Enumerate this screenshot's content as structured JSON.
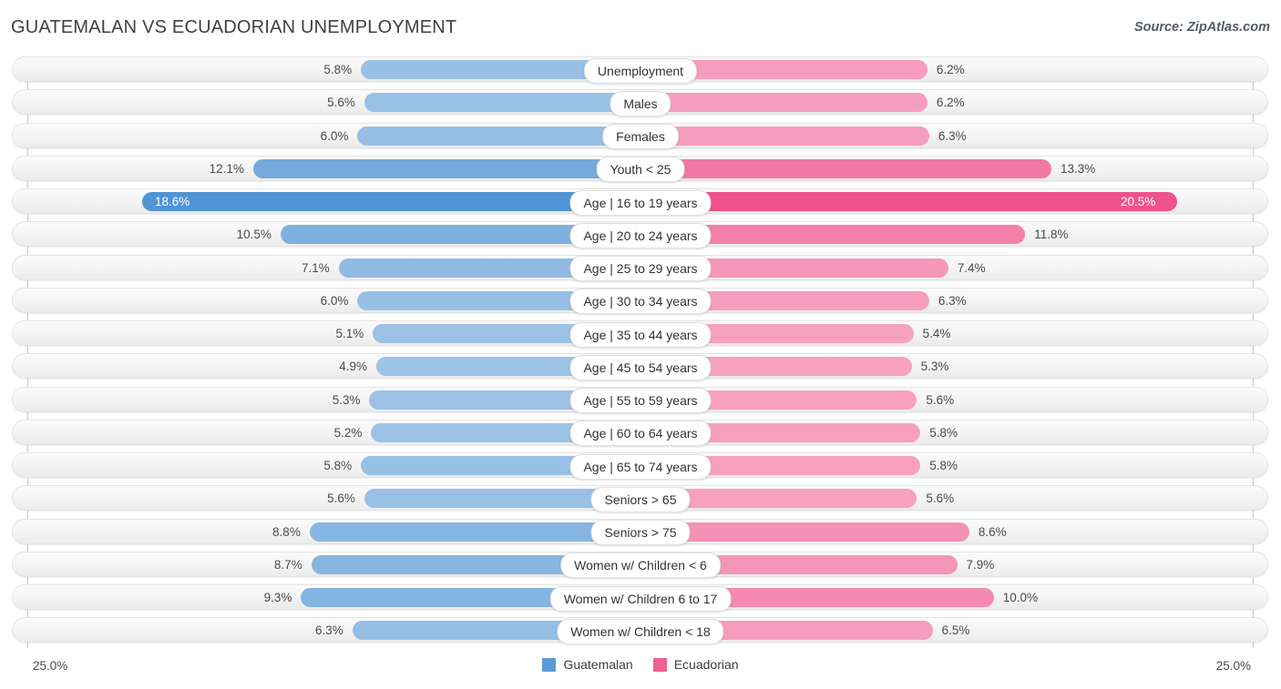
{
  "header": {
    "title": "GUATEMALAN VS ECUADORIAN UNEMPLOYMENT",
    "source": "Source: ZipAtlas.com"
  },
  "footer": {
    "axis_max_left": "25.0%",
    "axis_max_right": "25.0%",
    "legend": [
      {
        "label": "Guatemalan",
        "color": "#5b9bd5"
      },
      {
        "label": "Ecuadorian",
        "color": "#ef6093"
      }
    ]
  },
  "chart_data": {
    "type": "bar",
    "title": "GUATEMALAN VS ECUADORIAN UNEMPLOYMENT",
    "subtitle": "Source: ZipAtlas.com",
    "orientation": "horizontal-diverging",
    "xlabel": "",
    "ylabel": "",
    "xlim": [
      0,
      25
    ],
    "axis_max_label": "25.0%",
    "grid": false,
    "legend_position": "bottom-center",
    "categories": [
      "Unemployment",
      "Males",
      "Females",
      "Youth < 25",
      "Age | 16 to 19 years",
      "Age | 20 to 24 years",
      "Age | 25 to 29 years",
      "Age | 30 to 34 years",
      "Age | 35 to 44 years",
      "Age | 45 to 54 years",
      "Age | 55 to 59 years",
      "Age | 60 to 64 years",
      "Age | 65 to 74 years",
      "Seniors > 65",
      "Seniors > 75",
      "Women w/ Children < 6",
      "Women w/ Children 6 to 17",
      "Women w/ Children < 18"
    ],
    "series": [
      {
        "name": "Guatemalan",
        "side": "left",
        "color": "#5b9bd5",
        "values": [
          5.8,
          5.6,
          6.0,
          12.1,
          18.6,
          10.5,
          7.1,
          6.0,
          5.1,
          4.9,
          5.3,
          5.2,
          5.8,
          5.6,
          8.8,
          8.7,
          9.3,
          6.3
        ],
        "labels": [
          "5.8%",
          "5.6%",
          "6.0%",
          "12.1%",
          "18.6%",
          "10.5%",
          "7.1%",
          "6.0%",
          "5.1%",
          "4.9%",
          "5.3%",
          "5.2%",
          "5.8%",
          "5.6%",
          "8.8%",
          "8.7%",
          "9.3%",
          "6.3%"
        ]
      },
      {
        "name": "Ecuadorian",
        "side": "right",
        "color": "#ef6093",
        "values": [
          6.2,
          6.2,
          6.3,
          13.3,
          20.5,
          11.8,
          7.4,
          6.3,
          5.4,
          5.3,
          5.6,
          5.8,
          5.8,
          5.6,
          8.6,
          7.9,
          10.0,
          6.5
        ],
        "labels": [
          "6.2%",
          "6.2%",
          "6.3%",
          "13.3%",
          "20.5%",
          "11.8%",
          "7.4%",
          "6.3%",
          "5.4%",
          "5.3%",
          "5.6%",
          "5.8%",
          "5.8%",
          "5.6%",
          "8.6%",
          "7.9%",
          "10.0%",
          "6.5%"
        ]
      }
    ]
  }
}
